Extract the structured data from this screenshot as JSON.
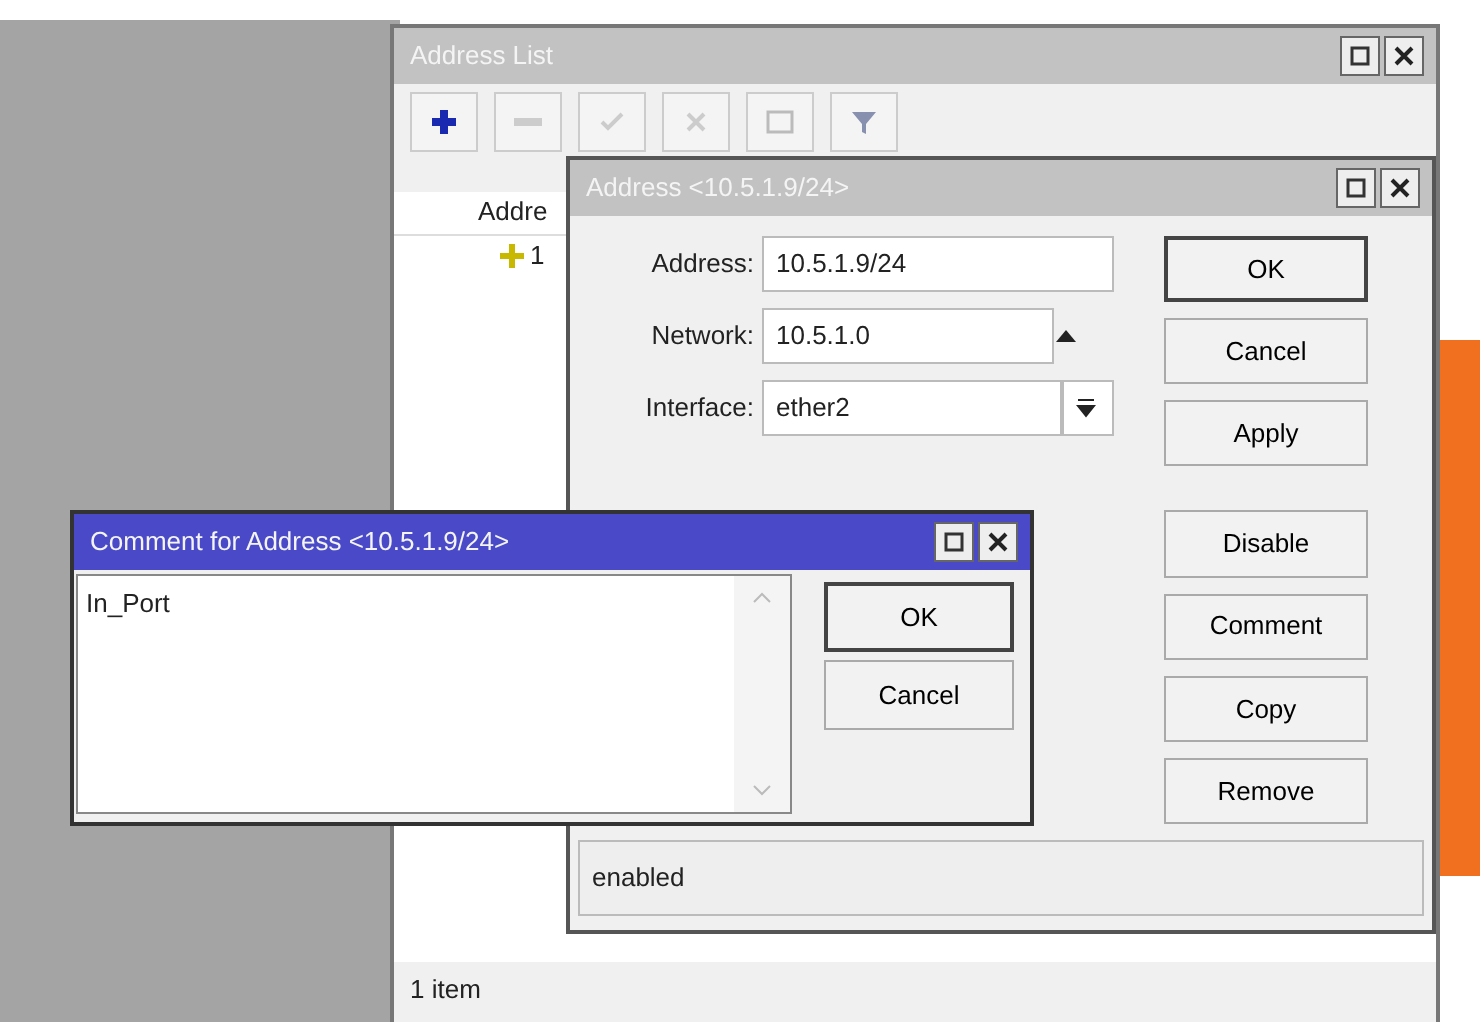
{
  "list_window": {
    "title": "Address List",
    "toolbar": [
      {
        "kind": "add"
      },
      {
        "kind": "remove"
      },
      {
        "kind": "enable"
      },
      {
        "kind": "disable"
      },
      {
        "kind": "comment"
      },
      {
        "kind": "filter"
      }
    ],
    "column_header": "Addre",
    "row_text": "1",
    "status": "1 item"
  },
  "address_dialog": {
    "title": "Address <10.5.1.9/24>",
    "fields": [
      {
        "label": "Address:",
        "value": "10.5.1.9/24",
        "kind": "plain"
      },
      {
        "label": "Network:",
        "value": "10.5.1.0",
        "kind": "arrow"
      },
      {
        "label": "Interface:",
        "value": "ether2",
        "kind": "dropdown"
      }
    ],
    "buttons": [
      {
        "label": "OK",
        "default": true
      },
      {
        "label": "Cancel",
        "default": false
      },
      {
        "label": "Apply",
        "default": false
      },
      {
        "label": "Disable",
        "default": false
      },
      {
        "label": "Comment",
        "default": false
      },
      {
        "label": "Copy",
        "default": false
      },
      {
        "label": "Remove",
        "default": false
      }
    ],
    "status": "enabled"
  },
  "comment_dialog": {
    "title": "Comment for Address <10.5.1.9/24>",
    "text": "In_Port",
    "buttons": [
      {
        "label": "OK",
        "default": true
      },
      {
        "label": "Cancel",
        "default": false
      }
    ]
  }
}
